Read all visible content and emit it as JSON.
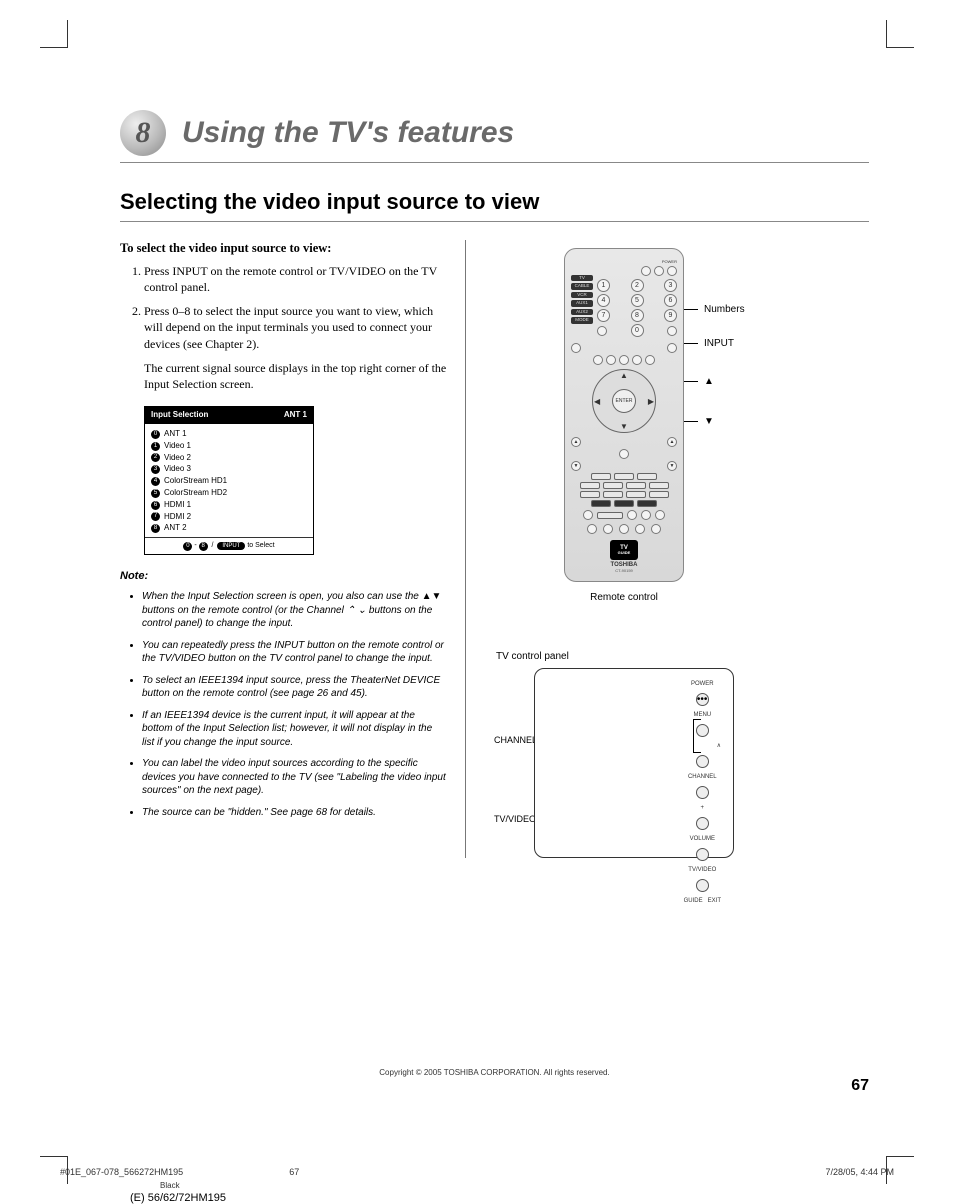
{
  "chapter": {
    "number": "8",
    "title": "Using the TV's features"
  },
  "section_title": "Selecting the video input source to view",
  "instructions": {
    "heading": "To select the video input source to view:",
    "step1": "Press INPUT on the remote control or TV/VIDEO on the TV control panel.",
    "step2": "Press 0–8 to select the input source you want to view, which will depend on the input terminals you used to connect your devices (see Chapter 2).",
    "step2_para": "The current signal source displays in the top right corner of the Input Selection screen."
  },
  "osd": {
    "title": "Input Selection",
    "current": "ANT 1",
    "items": [
      "ANT 1",
      "Video 1",
      "Video 2",
      "Video 3",
      "ColorStream HD1",
      "ColorStream HD2",
      "HDMI 1",
      "HDMI 2",
      "ANT 2"
    ],
    "item_nums": [
      "0",
      "1",
      "2",
      "3",
      "4",
      "5",
      "6",
      "7",
      "8"
    ],
    "foot_dash": "-",
    "foot_slash": "/",
    "foot_input": "INPUT",
    "foot_text": "to Select"
  },
  "note": {
    "heading": "Note:",
    "items": [
      "When the Input Selection screen is open, you also can use the ▲▼ buttons on the remote control (or the Channel ⌃ ⌄ buttons on the control panel) to change the input.",
      "You can repeatedly press the INPUT button on the remote control or the TV/VIDEO button on the TV control panel to change the input.",
      "To select an IEEE1394 input source, press the TheaterNet DEVICE button on the remote control (see page 26 and 45).",
      "If an IEEE1394 device is the current input, it will appear at the bottom of the Input Selection list; however, it will not display in the list if you change the input source.",
      "You can label the video input sources according to the specific devices you have connected to the TV (see \"Labeling the video input sources\" on the next page).",
      "The source can be \"hidden.\" See page 68 for details."
    ]
  },
  "remote": {
    "callout_numbers": "Numbers",
    "callout_input": "INPUT",
    "callout_up": "▲",
    "callout_down": "▼",
    "caption": "Remote control",
    "brand": "TOSHIBA",
    "model": "CT-90159",
    "enter": "ENTER",
    "tvguide_top": "TV",
    "tvguide_bot": "GUIDE",
    "side_labels": [
      "TV",
      "CABLE",
      "VCR",
      "AUX1",
      "AUX2",
      "MODE"
    ],
    "top_power": "POWER",
    "numbers": [
      "1",
      "2",
      "3",
      "4",
      "5",
      "6",
      "7",
      "8",
      "9",
      "0"
    ]
  },
  "control_panel": {
    "caption": "TV control panel",
    "callout_channel": "CHANNEL",
    "callout_channel_syms": "⌃ ⌄",
    "callout_tvvideo": "TV/VIDEO",
    "labels": {
      "power": "POWER",
      "menu": "MENU",
      "channel": "CHANNEL",
      "volume": "VOLUME",
      "tvvideo": "TV/VIDEO",
      "guide": "GUIDE",
      "exit": "EXIT"
    }
  },
  "footer": {
    "copyright": "Copyright © 2005 TOSHIBA CORPORATION. All rights reserved.",
    "page": "67",
    "file": "#01E_067-078_566272HM195",
    "file_page": "67",
    "date": "7/28/05, 4:44 PM",
    "black": "Black",
    "model": "(E) 56/62/72HM195"
  }
}
